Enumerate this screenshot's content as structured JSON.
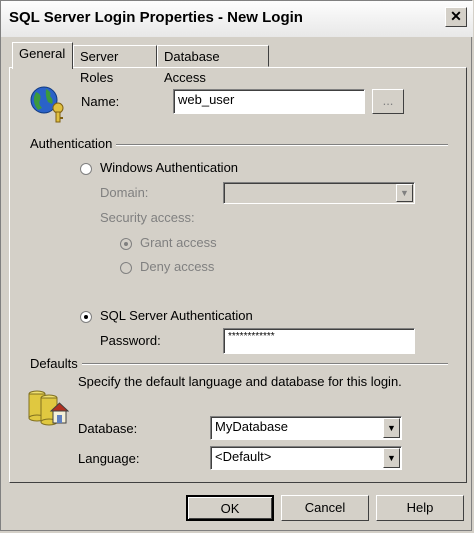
{
  "window": {
    "title": "SQL Server Login Properties - New Login",
    "close_glyph": "✕"
  },
  "tabs": [
    {
      "label": "General",
      "active": true
    },
    {
      "label": "Server Roles",
      "active": false
    },
    {
      "label": "Database Access",
      "active": false
    }
  ],
  "name": {
    "label": "Name:",
    "value": "web_user",
    "browse_label": "..."
  },
  "authentication": {
    "group_label": "Authentication",
    "windows": {
      "label": "Windows Authentication",
      "selected": false
    },
    "domain": {
      "label": "Domain:",
      "value": ""
    },
    "security_access": {
      "label": "Security access:"
    },
    "grant": {
      "label": "Grant access",
      "selected": true
    },
    "deny": {
      "label": "Deny access",
      "selected": false
    },
    "sql": {
      "label": "SQL Server Authentication",
      "selected": true
    },
    "password": {
      "label": "Password:",
      "value": "************"
    }
  },
  "defaults": {
    "group_label": "Defaults",
    "description": "Specify the default language and database for this login.",
    "database": {
      "label": "Database:",
      "value": "MyDatabase"
    },
    "language": {
      "label": "Language:",
      "value": "<Default>"
    }
  },
  "buttons": {
    "ok": "OK",
    "cancel": "Cancel",
    "help": "Help"
  }
}
